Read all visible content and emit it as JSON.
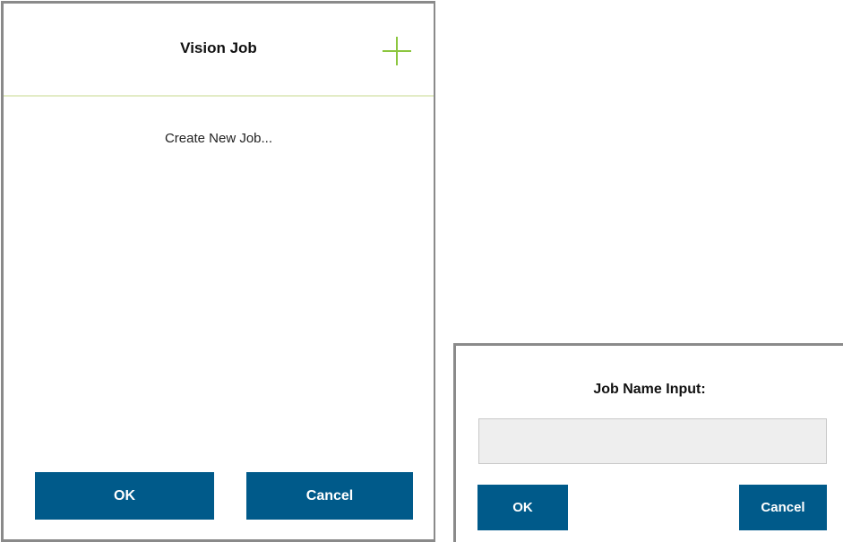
{
  "vision_job_dialog": {
    "title": "Vision Job",
    "add_icon": "plus-icon",
    "items": [
      {
        "label": "Create New Job..."
      }
    ],
    "ok_label": "OK",
    "cancel_label": "Cancel"
  },
  "job_name_dialog": {
    "title": "Job Name Input:",
    "input_value": "",
    "input_placeholder": "",
    "ok_label": "OK",
    "cancel_label": "Cancel"
  },
  "colors": {
    "button_bg": "#005a8a",
    "accent_green": "#8cc63f",
    "header_divider": "#e3ecc6",
    "input_bg": "#eeeeee",
    "frame_border": "#8a8a8a"
  }
}
